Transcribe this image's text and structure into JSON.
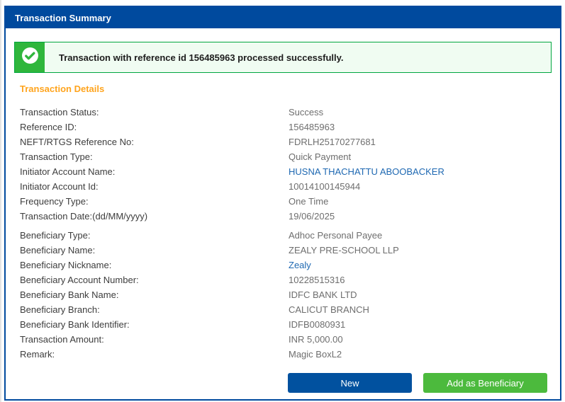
{
  "panel": {
    "title": "Transaction Summary"
  },
  "alert": {
    "icon": "check-circle",
    "message": "Transaction with reference id 156485963 processed successfully."
  },
  "details": {
    "heading": "Transaction Details",
    "rows": [
      {
        "label": "Transaction Status:",
        "value": "Success"
      },
      {
        "label": "Reference ID:",
        "value": "156485963"
      },
      {
        "label": "NEFT/RTGS Reference No:",
        "value": "FDRLH25170277681"
      },
      {
        "label": "Transaction Type:",
        "value": "Quick Payment"
      },
      {
        "label": "Initiator Account Name:",
        "value": "HUSNA THACHATTU ABOOBACKER"
      },
      {
        "label": "Initiator Account Id:",
        "value": "10014100145944"
      },
      {
        "label": "Frequency Type:",
        "value": "One Time"
      },
      {
        "label": "Transaction Date:(dd/MM/yyyy)",
        "value": "19/06/2025"
      },
      {
        "label": "Beneficiary Type:",
        "value": "Adhoc Personal Payee"
      },
      {
        "label": "Beneficiary Name:",
        "value": "ZEALY PRE-SCHOOL LLP"
      },
      {
        "label": "Beneficiary Nickname:",
        "value": "Zealy"
      },
      {
        "label": "Beneficiary Account Number:",
        "value": "10228515316"
      },
      {
        "label": "Beneficiary Bank Name:",
        "value": "IDFC BANK LTD"
      },
      {
        "label": "Beneficiary Branch:",
        "value": "CALICUT BRANCH"
      },
      {
        "label": "Beneficiary Bank Identifier:",
        "value": "IDFB0080931"
      },
      {
        "label": "Transaction Amount:",
        "value": "INR 5,000.00"
      },
      {
        "label": "Remark:",
        "value": "Magic BoxL2"
      }
    ]
  },
  "buttons": {
    "new_label": "New",
    "add_beneficiary_label": "Add as Beneficiary"
  },
  "colors": {
    "header_blue": "#004a9e",
    "panel_border_blue": "#004a9e",
    "alert_border_green": "#00a63f",
    "alert_icon_green": "#2fb63c",
    "alert_bg_green": "#f0fcf2",
    "heading_orange": "#ffa41d",
    "link_blue": "#1e68b2",
    "label_gray": "#3d3d3d",
    "value_gray": "#6e6e6e",
    "button_blue": "#01519f",
    "button_green": "#4cba3d"
  }
}
